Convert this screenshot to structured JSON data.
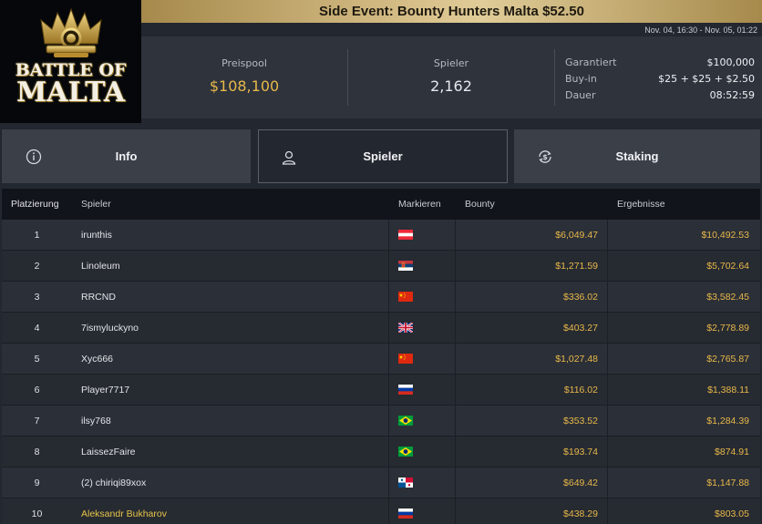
{
  "logo": {
    "line1": "BATTLE OF",
    "line2": "MALTA"
  },
  "header": {
    "title": "Side Event: Bounty Hunters Malta $52.50",
    "date_range": "Nov. 04, 16:30 - Nov. 05, 01:22"
  },
  "stats": {
    "prizepool_label": "Preispool",
    "prizepool_value": "$108,100",
    "players_label": "Spieler",
    "players_value": "2,162",
    "details": [
      {
        "label": "Garantiert",
        "value": "$100,000"
      },
      {
        "label": "Buy-in",
        "value": "$25 + $25 + $2.50"
      },
      {
        "label": "Dauer",
        "value": "08:52:59"
      }
    ]
  },
  "tabs": [
    {
      "label": "Info",
      "icon": "info-icon"
    },
    {
      "label": "Spieler",
      "icon": "user-icon",
      "active": true
    },
    {
      "label": "Staking",
      "icon": "dollar-exchange-icon"
    }
  ],
  "table": {
    "headers": {
      "place": "Platzierung",
      "player": "Spieler",
      "mark": "Markieren",
      "bounty": "Bounty",
      "result": "Ergebnisse"
    },
    "rows": [
      {
        "place": "1",
        "player": "irunthis",
        "flag": "austria",
        "bounty": "$6,049.47",
        "result": "$10,492.53"
      },
      {
        "place": "2",
        "player": "Linoleum",
        "flag": "serbia",
        "bounty": "$1,271.59",
        "result": "$5,702.64"
      },
      {
        "place": "3",
        "player": "RRCND",
        "flag": "china",
        "bounty": "$336.02",
        "result": "$3,582.45"
      },
      {
        "place": "4",
        "player": "7ismyluckyno",
        "flag": "uk",
        "bounty": "$403.27",
        "result": "$2,778.89"
      },
      {
        "place": "5",
        "player": "Xyc666",
        "flag": "china",
        "bounty": "$1,027.48",
        "result": "$2,765.87"
      },
      {
        "place": "6",
        "player": "Player7717",
        "flag": "russia",
        "bounty": "$116.02",
        "result": "$1,388.11"
      },
      {
        "place": "7",
        "player": "ilsy768",
        "flag": "brazil",
        "bounty": "$353.52",
        "result": "$1,284.39"
      },
      {
        "place": "8",
        "player": "LaissezFaire",
        "flag": "brazil",
        "bounty": "$193.74",
        "result": "$874.91"
      },
      {
        "place": "9",
        "player": "(2) chiriqi89xox",
        "flag": "panama",
        "bounty": "$649.42",
        "result": "$1,147.88"
      },
      {
        "place": "10",
        "player": "Aleksandr Bukharov",
        "flag": "russia",
        "bounty": "$438.29",
        "result": "$803.05",
        "highlight": true
      }
    ]
  },
  "colors": {
    "accent_gold": "#e8b84a",
    "highlight_name": "#e6c44a",
    "title_bar": "#d8c08a"
  }
}
